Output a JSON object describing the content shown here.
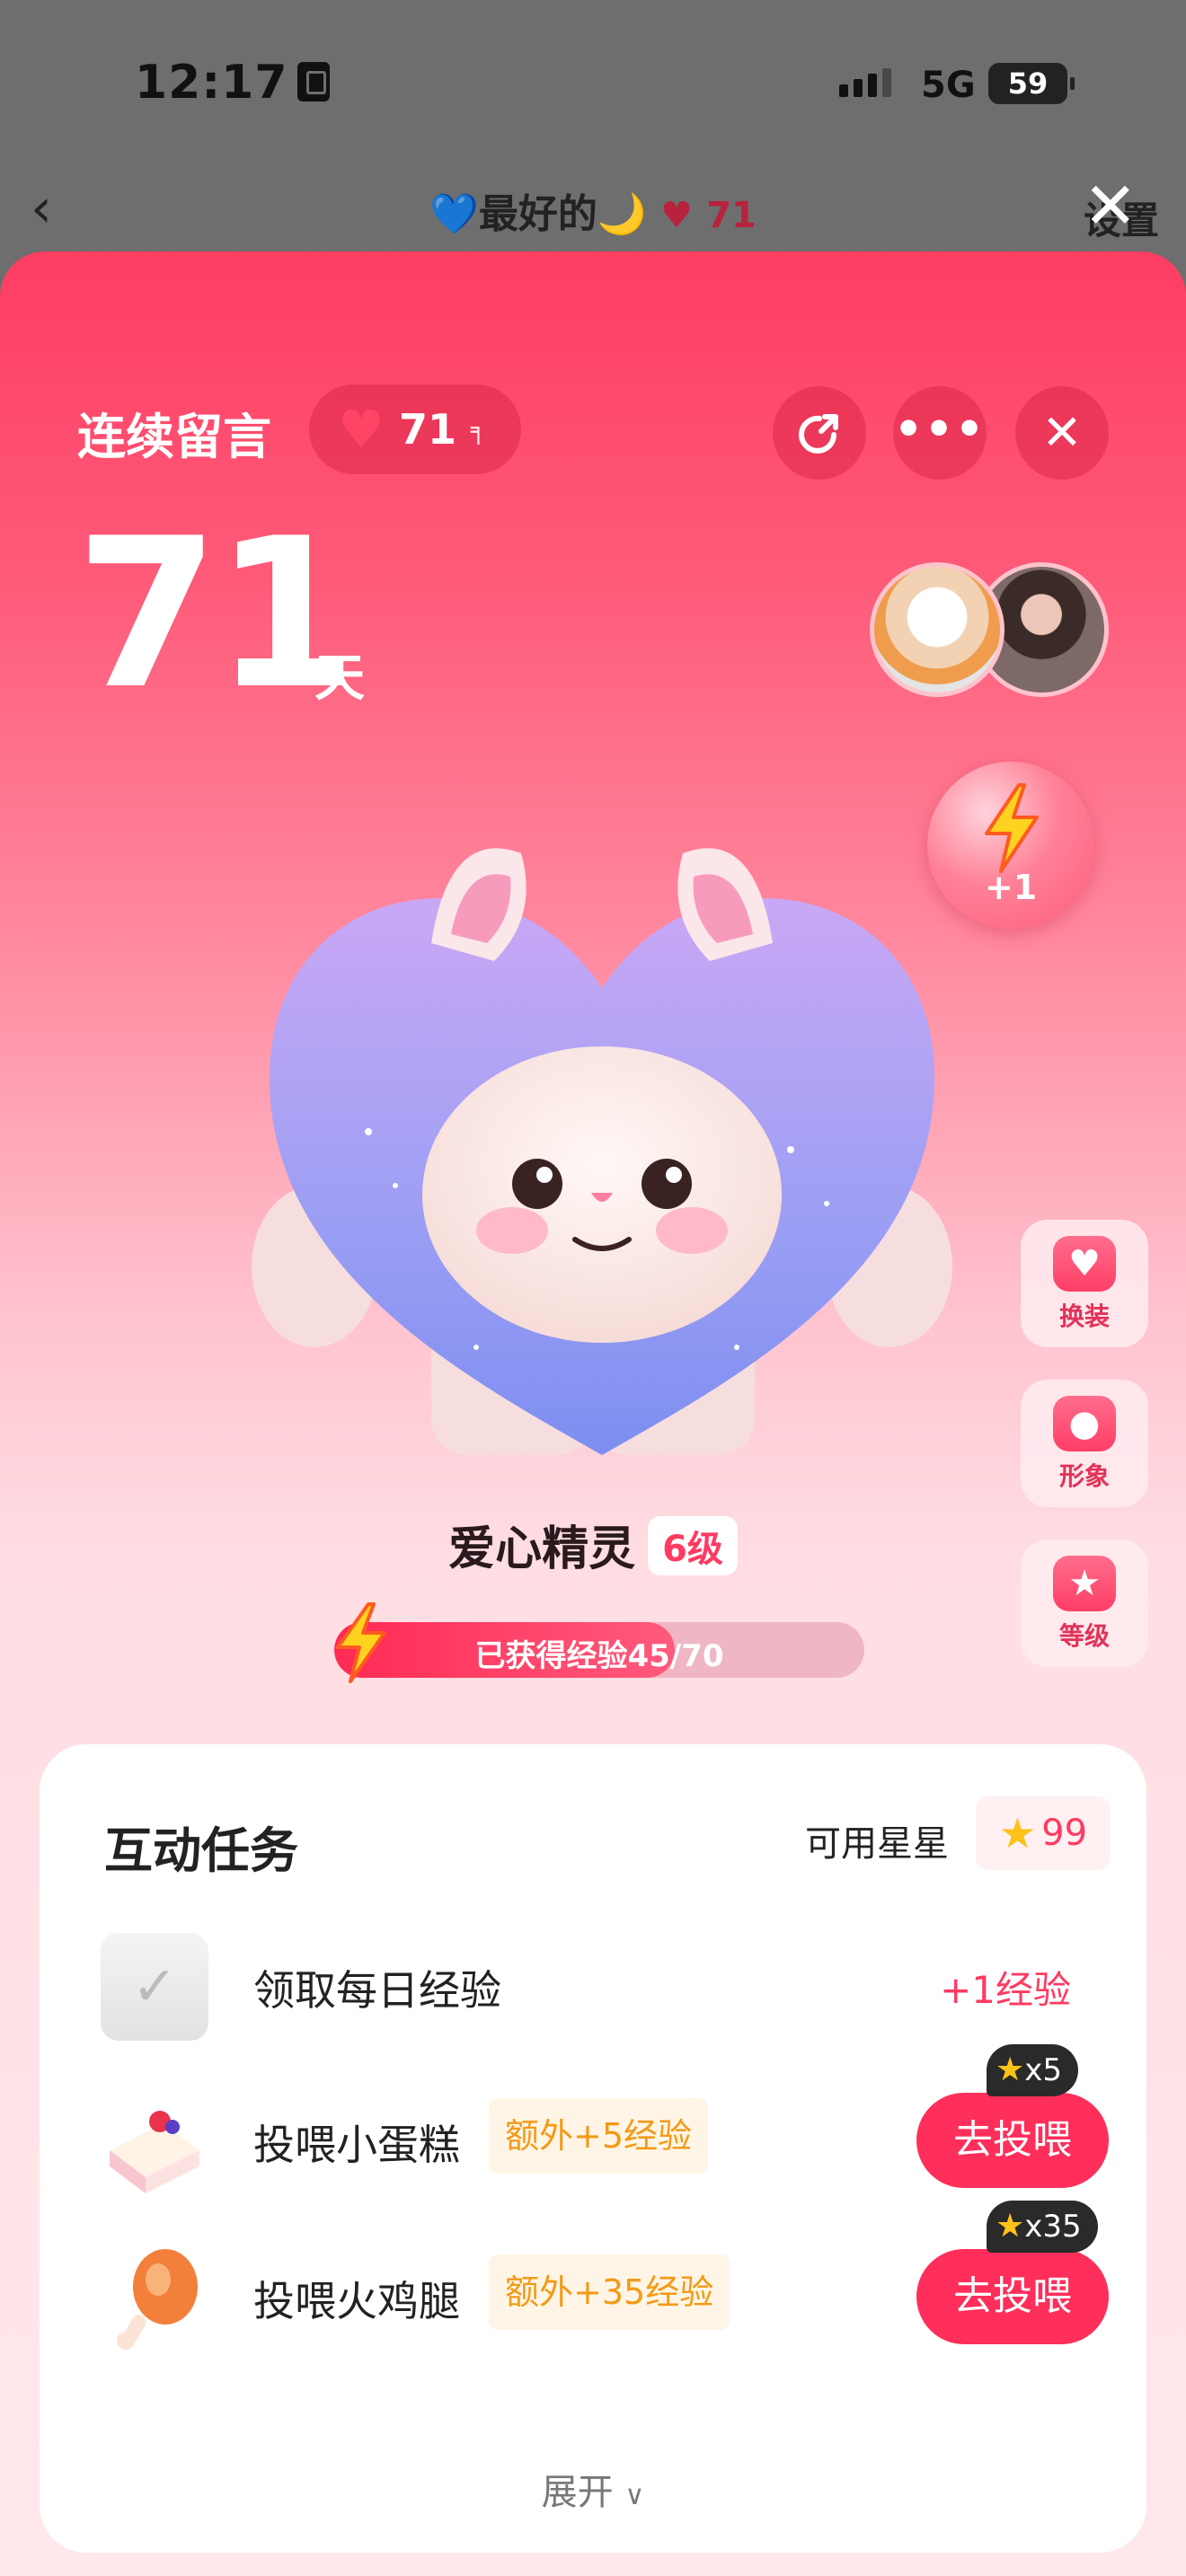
{
  "status_bar": {
    "time": "12:17",
    "network": "5G",
    "battery": "59"
  },
  "nav": {
    "back_icon": "chevron-left-icon",
    "title_name": "💙最好的🌙",
    "title_count": "71",
    "settings_label": "设置",
    "close_icon": "close-icon"
  },
  "header": {
    "streak_label": "连续留言",
    "streak_pill_count": "71",
    "days_value": "71",
    "days_unit": "天",
    "share_icon": "share-icon",
    "more_icon": "more-icon",
    "close_icon": "close-icon"
  },
  "energy": {
    "label": "+1",
    "icon": "lightning-icon"
  },
  "side_buttons": [
    {
      "label": "换装",
      "icon": "shirt-icon"
    },
    {
      "label": "形象",
      "icon": "pig-face-icon"
    },
    {
      "label": "等级",
      "icon": "star-icon"
    }
  ],
  "pet": {
    "name": "爱心精灵",
    "level": "6级",
    "xp_text": "已获得经验45/70",
    "xp_current": 45,
    "xp_max": 70
  },
  "tasks": {
    "title": "互动任务",
    "stars_label": "可用星星",
    "stars_value": "99",
    "items": [
      {
        "name": "领取每日经验",
        "reward": "+1经验",
        "icon": "checkmark-icon"
      },
      {
        "name": "投喂小蛋糕",
        "extra": "额外+5经验",
        "button": "去投喂",
        "cost": "x5",
        "icon": "cake-icon"
      },
      {
        "name": "投喂火鸡腿",
        "extra": "额外+35经验",
        "button": "去投喂",
        "cost": "x35",
        "icon": "drumstick-icon"
      }
    ],
    "expand_label": "展开"
  },
  "colors": {
    "accent": "#ff2e5a",
    "sheet_top": "#fe3d62",
    "extra_tag_text": "#f39a16"
  }
}
